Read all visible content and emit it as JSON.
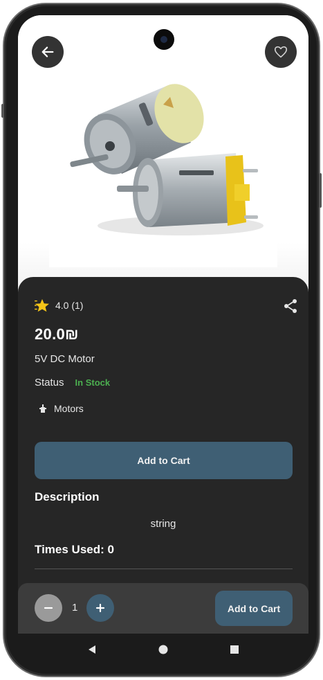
{
  "product": {
    "rating": "4.0 (1)",
    "price": "20.0₪",
    "name": "5V DC Motor",
    "status_label": "Status",
    "status_value": "In Stock",
    "category": "Motors",
    "add_to_cart_label": "Add to Cart",
    "description_title": "Description",
    "description": "string",
    "times_used": "Times Used: 0"
  },
  "cart_bar": {
    "quantity": "1",
    "add_to_cart_label": "Add to Cart"
  },
  "icons": {
    "back": "arrow-left-icon",
    "favorite": "heart-icon",
    "rating": "star-icon",
    "share": "share-icon",
    "category": "motor-icon",
    "minus": "minus-icon",
    "plus": "plus-icon",
    "nav_back": "triangle-back-icon",
    "nav_home": "circle-home-icon",
    "nav_recents": "square-recents-icon"
  },
  "colors": {
    "sheet_bg": "#262626",
    "accent": "#3f5f74",
    "in_stock": "#4caf50",
    "star": "#f5c518"
  }
}
